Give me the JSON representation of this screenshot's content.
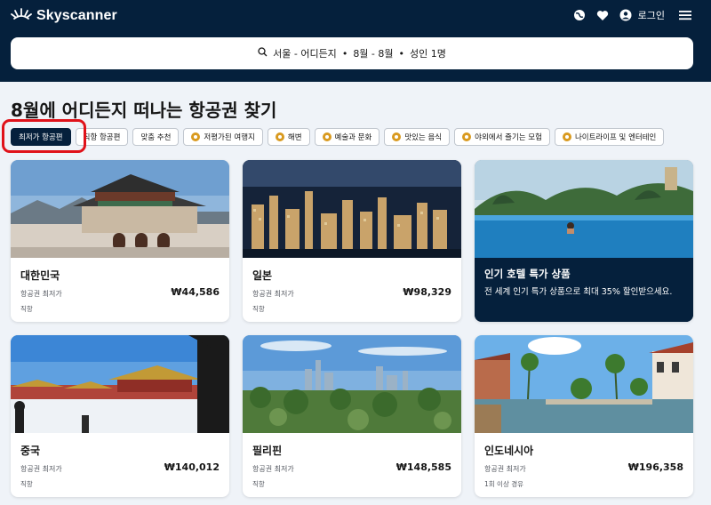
{
  "header": {
    "brand": "Skyscanner",
    "login_label": "로그인",
    "icons": [
      "globe-icon",
      "heart-icon",
      "user-icon",
      "menu-icon"
    ],
    "color": "#05203c"
  },
  "search": {
    "origin_destination": "서울 - 어디든지",
    "dates": "8월 - 8월",
    "passengers": "성인 1명",
    "separator": "•"
  },
  "page_title": "8월에 어디든지 떠나는 항공권 찾기",
  "chips": [
    {
      "label": "최저가 항공편",
      "active": true,
      "icon": ""
    },
    {
      "label": "직항 항공편",
      "active": false,
      "icon": ""
    },
    {
      "label": "맞춤 추천",
      "active": false,
      "icon": ""
    },
    {
      "label": "저평가된 여행지",
      "active": false,
      "icon": "star-badge-icon"
    },
    {
      "label": "해변",
      "active": false,
      "icon": "star-badge-icon"
    },
    {
      "label": "예술과 문화",
      "active": false,
      "icon": "star-badge-icon"
    },
    {
      "label": "맛있는 음식",
      "active": false,
      "icon": "star-badge-icon"
    },
    {
      "label": "야외에서 즐기는 모험",
      "active": false,
      "icon": "star-badge-icon"
    },
    {
      "label": "나이트라이프 및 엔터테인",
      "active": false,
      "icon": "star-badge-icon"
    }
  ],
  "cards": [
    {
      "name": "대한민국",
      "sub": "항공권 최저가",
      "price": "₩44,586",
      "note": "직항",
      "image": "gyeongbokgung-palace"
    },
    {
      "name": "일본",
      "sub": "항공권 최저가",
      "price": "₩98,329",
      "note": "직항",
      "image": "tokyo-night-skyline"
    },
    {
      "name": "중국",
      "sub": "항공권 최저가",
      "price": "₩140,012",
      "note": "직항",
      "image": "forbidden-city-snow"
    },
    {
      "name": "필리핀",
      "sub": "항공권 최저가",
      "price": "₩148,585",
      "note": "직항",
      "image": "manila-skyline"
    },
    {
      "name": "인도네시아",
      "sub": "항공권 최저가",
      "price": "₩196,358",
      "note": "1회 이상 경유",
      "image": "jakarta-canal"
    }
  ],
  "promo": {
    "title": "인기 호텔 특가 상품",
    "description": "전 세계 인기 특가 상품으로 최대 35% 할인받으세요.",
    "image": "infinity-pool"
  },
  "colors": {
    "accent_navy": "#05203c",
    "page_bg": "#eff3f8",
    "highlight_red": "#e0121a"
  }
}
